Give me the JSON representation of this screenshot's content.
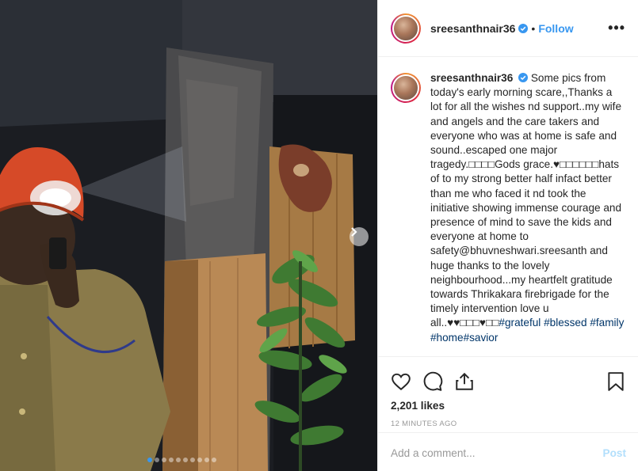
{
  "post": {
    "username": "sreesanthnair36",
    "follow_label": "Follow",
    "separator": "•",
    "more_label": "•••",
    "caption_text": " Some pics from today's early morning scare,,Thanks a lot for all the wishes nd support..my wife and angels and the care takers and everyone who was at home is safe and sound..escaped one major tragedy.□□□□Gods grace.♥□□□□□□hats of to my strong better half infact better than me who faced it nd took the initiative showing immense courage and presence of mind to save the kids and everyone at home to safety@bhuvneshwari.sreesanth and huge thanks to the lovely neighbourhood...my heartfelt gratitude towards Thrikakara firebrigade for the timely intervention love u all..♥♥□□□♥□□",
    "hashtags": [
      "#grateful",
      "#blessed",
      "#family",
      "#home",
      "#savior"
    ],
    "likes": "2,201 likes",
    "timestamp": "12 MINUTES AGO",
    "comment_placeholder": "Add a comment...",
    "post_button": "Post"
  },
  "carousel": {
    "total": 10,
    "current": 1
  },
  "icons": {
    "like": "heart-icon",
    "comment": "comment-icon",
    "share": "share-icon",
    "save": "bookmark-icon",
    "verified": "verified-badge-icon",
    "next": "chevron-right-icon"
  },
  "colors": {
    "accent": "#3897f0",
    "hashtag": "#003569",
    "muted": "#999999",
    "post_disabled": "#b2dffc"
  }
}
